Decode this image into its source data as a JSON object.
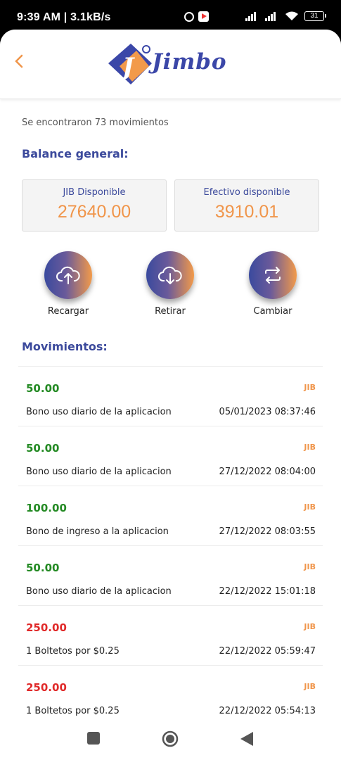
{
  "status_bar": {
    "time": "9:39 AM | 3.1kB/s",
    "battery": "31"
  },
  "header": {
    "logo_text": "Jimbo"
  },
  "summary_text": "Se encontraron 73 movimientos",
  "balance": {
    "title": "Balance general:",
    "jib_label": "JIB Disponible",
    "jib_value": "27640.00",
    "cash_label": "Efectivo disponible",
    "cash_value": "3910.01"
  },
  "actions": {
    "recharge": "Recargar",
    "withdraw": "Retirar",
    "exchange": "Cambiar"
  },
  "movements_title": "Movimientos:",
  "movements": [
    {
      "amount": "50.00",
      "currency": "JIB",
      "description": "Bono uso diario de la aplicacion",
      "date": "05/01/2023 08:37:46",
      "type": "credit"
    },
    {
      "amount": "50.00",
      "currency": "JIB",
      "description": "Bono uso diario de la aplicacion",
      "date": "27/12/2022 08:04:00",
      "type": "credit"
    },
    {
      "amount": "100.00",
      "currency": "JIB",
      "description": "Bono de ingreso a la aplicacion",
      "date": "27/12/2022 08:03:55",
      "type": "credit"
    },
    {
      "amount": "50.00",
      "currency": "JIB",
      "description": "Bono uso diario de la aplicacion",
      "date": "22/12/2022 15:01:18",
      "type": "credit"
    },
    {
      "amount": "250.00",
      "currency": "JIB",
      "description": "1 Boltetos por $0.25",
      "date": "22/12/2022 05:59:47",
      "type": "debit"
    },
    {
      "amount": "250.00",
      "currency": "JIB",
      "description": "1 Boltetos por $0.25",
      "date": "22/12/2022 05:54:13",
      "type": "debit"
    }
  ],
  "colors": {
    "primary_blue": "#3c4a9c",
    "accent_orange": "#f0954a",
    "credit_green": "#248a24",
    "debit_red": "#e02a2a"
  },
  "icons": {
    "back": "chevron-left-icon",
    "recharge": "cloud-upload-icon",
    "withdraw": "cloud-download-icon",
    "exchange": "swap-arrows-icon",
    "nav_recent": "square-icon",
    "nav_home": "circle-icon",
    "nav_back": "triangle-back-icon"
  }
}
